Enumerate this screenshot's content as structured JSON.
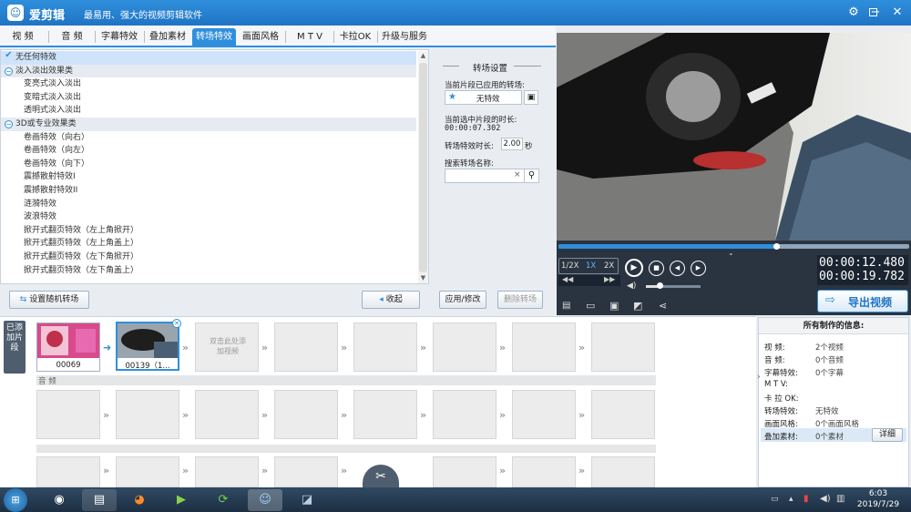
{
  "app": {
    "title": "爱剪辑",
    "subtitle": "最易用、强大的视频剪辑软件",
    "logo_icon": "☺"
  },
  "window": {
    "controls": [
      "settings-icon",
      "minimize-icon",
      "restore-icon",
      "close-icon"
    ]
  },
  "menu": {
    "tabs": [
      "视 频",
      "音 频",
      "字幕特效",
      "叠加素材",
      "转场特效",
      "画面风格",
      "M T V",
      "卡拉OK",
      "升级与服务"
    ],
    "active_index": 4
  },
  "effects": {
    "items": [
      {
        "type": "sel",
        "label": "无任何特效"
      },
      {
        "type": "group",
        "label": "淡入淡出效果类"
      },
      {
        "type": "item",
        "label": "变亮式淡入淡出"
      },
      {
        "type": "item",
        "label": "变暗式淡入淡出"
      },
      {
        "type": "item",
        "label": "透明式淡入淡出"
      },
      {
        "type": "group",
        "label": "3D或专业效果类"
      },
      {
        "type": "item",
        "label": "卷画特效（向右）"
      },
      {
        "type": "item",
        "label": "卷画特效（向左）"
      },
      {
        "type": "item",
        "label": "卷画特效（向下）"
      },
      {
        "type": "item",
        "label": "震撼散射特效I"
      },
      {
        "type": "item",
        "label": "震撼散射特效II"
      },
      {
        "type": "item",
        "label": "涟漪特效"
      },
      {
        "type": "item",
        "label": "波浪特效"
      },
      {
        "type": "item",
        "label": "掀开式翻页特效（左上角掀开）"
      },
      {
        "type": "item",
        "label": "掀开式翻页特效（左上角盖上）"
      },
      {
        "type": "item",
        "label": "掀开式翻页特效（左下角掀开）"
      },
      {
        "type": "item",
        "label": "掀开式翻页特效（左下角盖上）"
      }
    ],
    "random_button": "设置随机转场",
    "collapse_button": "收起"
  },
  "settings": {
    "heading": "转场设置",
    "applied_label": "当前片段已应用的转场:",
    "applied_value": "无特效",
    "duration_label": "当前选中片段的时长:",
    "duration_value": "00:00:07.302",
    "effect_duration_label": "转场特效时长:",
    "effect_duration_value": "2.00",
    "effect_duration_unit": "秒",
    "search_label": "搜索转场名称:",
    "search_value": "",
    "search_clear": "×",
    "apply_button": "应用/修改",
    "delete_button": "删除转场"
  },
  "player": {
    "progress": 0.62,
    "speeds": [
      "1/2X",
      "1X",
      "2X"
    ],
    "active_speed": "1X",
    "current_time": "00:00:12.480",
    "total_time": "00:00:19.782",
    "volume": 0.25,
    "export_button": "导出视频"
  },
  "timeline": {
    "side_label": "已添加片段",
    "clip1_label": "00069",
    "clip2_label": "00139（1...",
    "placeholder": "双击此处添加视频",
    "audio_label": "音 频"
  },
  "info": {
    "title": "所有制作的信息:",
    "rows": [
      {
        "k": "视    频:",
        "v": "2个视频"
      },
      {
        "k": "音    频:",
        "v": "0个音频"
      },
      {
        "k": "字幕特效:",
        "v": "0个字幕"
      },
      {
        "k": "M  T  V:",
        "v": ""
      },
      {
        "k": "卡 拉 OK:",
        "v": ""
      },
      {
        "k": "转场特效:",
        "v": "无特效"
      },
      {
        "k": "画面风格:",
        "v": "0个画面风格"
      },
      {
        "k": "叠加素材:",
        "v": "0个素材"
      }
    ],
    "detail_button": "详细"
  },
  "taskbar": {
    "time": "6:03",
    "date": "2019/7/29"
  }
}
